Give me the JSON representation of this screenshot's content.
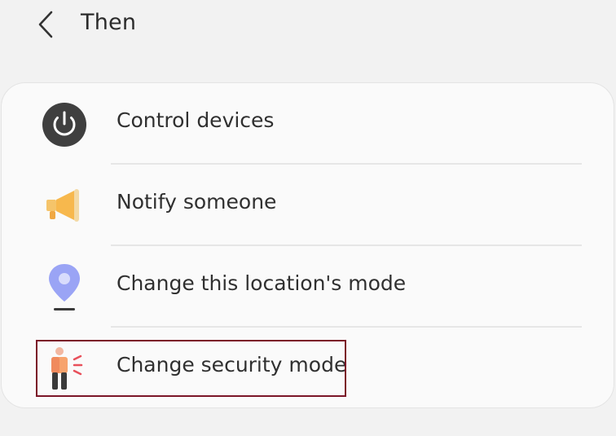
{
  "header": {
    "title": "Then",
    "back_icon": "chevron-left-icon"
  },
  "items": [
    {
      "label": "Control devices",
      "icon": "power-icon",
      "icon_color": "#3f3f3f"
    },
    {
      "label": "Notify someone",
      "icon": "megaphone-icon",
      "icon_color": "#f5c46a"
    },
    {
      "label": "Change this location's mode",
      "icon": "location-pin-icon",
      "icon_color": "#9aa4f5"
    },
    {
      "label": "Change security mode",
      "icon": "security-person-icon",
      "icon_color": "#f08a5d"
    }
  ],
  "highlight_color": "#7b1528"
}
